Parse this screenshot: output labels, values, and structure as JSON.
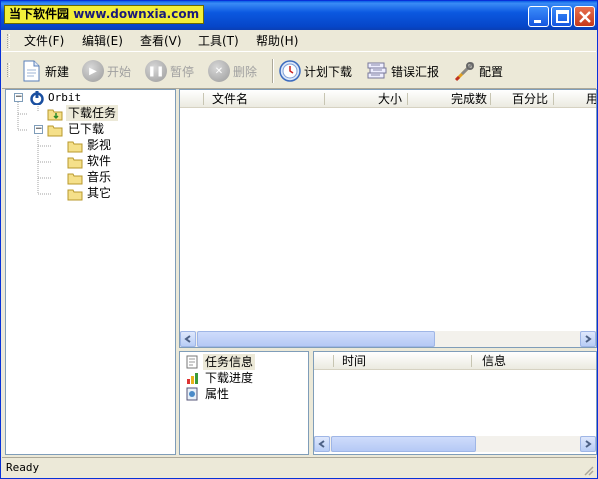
{
  "window": {
    "title_app": "当下软件园",
    "title_url": "www.downxia.com",
    "colors": {
      "titlebar": "#0a5fe6",
      "badge": "#f2ef3a",
      "selection": "#ece9d8",
      "border": "#7f9db9"
    }
  },
  "menu": {
    "items": [
      {
        "label": "文件(F)"
      },
      {
        "label": "编辑(E)"
      },
      {
        "label": "查看(V)"
      },
      {
        "label": "工具(T)"
      },
      {
        "label": "帮助(H)"
      }
    ]
  },
  "toolbar": {
    "new_label": "新建",
    "start_label": "开始",
    "pause_label": "暂停",
    "delete_label": "删除",
    "schedule_label": "计划下载",
    "error_label": "错误汇报",
    "config_label": "配置"
  },
  "tree": {
    "root": "Orbit",
    "downloading": "下载任务",
    "downloaded": "已下载",
    "folders": [
      "影视",
      "软件",
      "音乐",
      "其它"
    ]
  },
  "task_table": {
    "columns": [
      "文件名",
      "大小",
      "完成数",
      "百分比",
      "用"
    ]
  },
  "info_list": {
    "items": [
      "任务信息",
      "下载进度",
      "属性"
    ]
  },
  "log_table": {
    "columns": [
      "时间",
      "信息"
    ]
  },
  "status": {
    "text": "Ready"
  }
}
